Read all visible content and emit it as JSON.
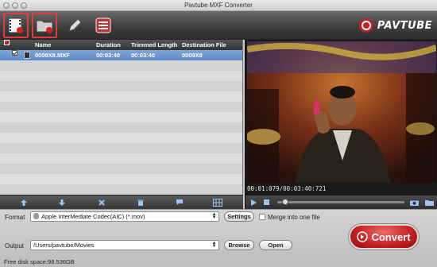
{
  "window": {
    "title": "Pavtube MXF Converter"
  },
  "toolbar": {
    "buttons": [
      {
        "name": "add-video-button",
        "icon": "film-add-icon",
        "highlighted": true
      },
      {
        "name": "add-folder-button",
        "icon": "folder-add-icon",
        "highlighted": true
      },
      {
        "name": "edit-button",
        "icon": "pencil-icon",
        "highlighted": false
      },
      {
        "name": "task-list-button",
        "icon": "list-icon",
        "highlighted": false
      }
    ],
    "brand": "PAVTUBE"
  },
  "file_list": {
    "columns": [
      "Name",
      "Duration",
      "Trimmed Length",
      "Destination File"
    ],
    "rows": [
      {
        "checked": true,
        "name": "0009X8.MXF",
        "duration": "00:03:40",
        "trimmed": "00:03:40",
        "destination": "0009X8"
      }
    ]
  },
  "file_list_actions": [
    {
      "name": "move-up-button",
      "icon": "arrow-up-icon"
    },
    {
      "name": "move-down-button",
      "icon": "arrow-down-icon"
    },
    {
      "name": "remove-button",
      "icon": "x-icon"
    },
    {
      "name": "delete-all-button",
      "icon": "trash-icon"
    },
    {
      "name": "subtitle-button",
      "icon": "speech-bubble-icon"
    },
    {
      "name": "merge-button",
      "icon": "grid-icon"
    }
  ],
  "preview": {
    "timecode": "00:01:079/00:03:40:721",
    "progress": 0.04
  },
  "bottom": {
    "format_label": "Format",
    "format_value": "Apple InterMediate Codec(AIC) (*.mov)",
    "settings_label": "Settings",
    "merge_label": "Merge into one file",
    "output_label": "Output",
    "output_value": "/Users/pavtube/Movies",
    "browse_label": "Browse",
    "open_label": "Open",
    "convert_label": "Convert",
    "free_space": "Free disk space:98.536GB"
  },
  "colors": {
    "accent": "#c51f1f",
    "selection": "#5a88c8",
    "highlight": "#e23a3a"
  }
}
